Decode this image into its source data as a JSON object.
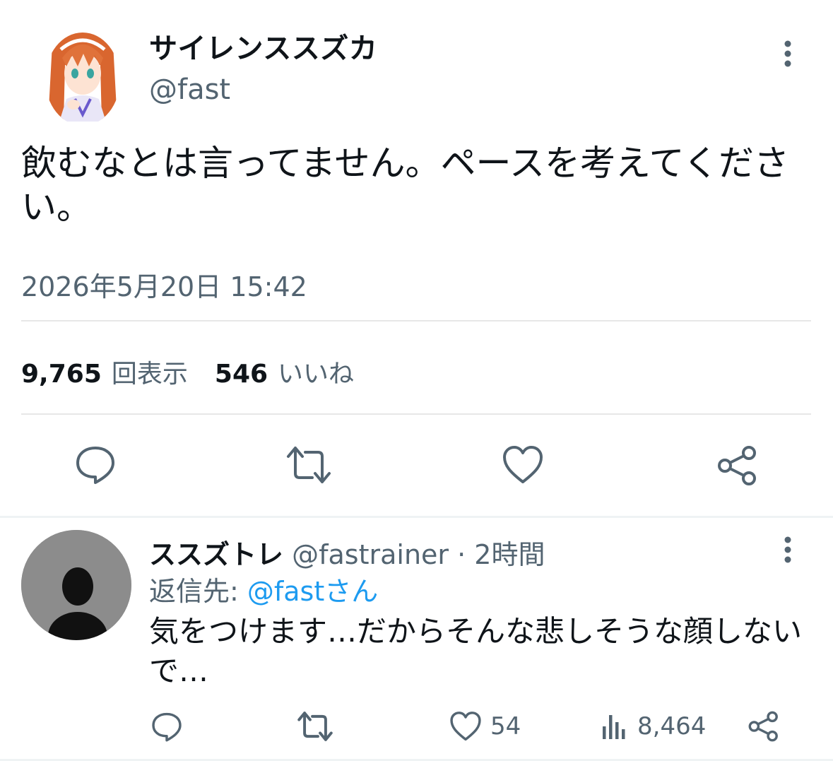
{
  "tweet": {
    "author_name": "サイレンススズカ",
    "author_handle": "@fast",
    "text": "飲むなとは言ってません。ペースを考えてください。",
    "timestamp": "2026年5月20日 15:42",
    "views_count": "9,765",
    "views_label": "回表示",
    "likes_count": "546",
    "likes_label": "いいね"
  },
  "reply": {
    "author_name": "ススズトレ",
    "author_handle": "@fastrainer",
    "separator": " · ",
    "time": "2時間",
    "reply_to_label": "返信先: ",
    "reply_to_handle": "@fastさん",
    "text": "気をつけます…だからそんな悲しそうな顔しないで…",
    "likes": "54",
    "views": "8,464"
  },
  "icons": [
    "more-vertical-icon",
    "reply-icon",
    "retweet-icon",
    "like-icon",
    "share-icon",
    "views-icon"
  ],
  "colors": {
    "text": "#0f1419",
    "secondary": "#536471",
    "accent": "#1d9bf0",
    "divider": "#e7e7e7"
  }
}
